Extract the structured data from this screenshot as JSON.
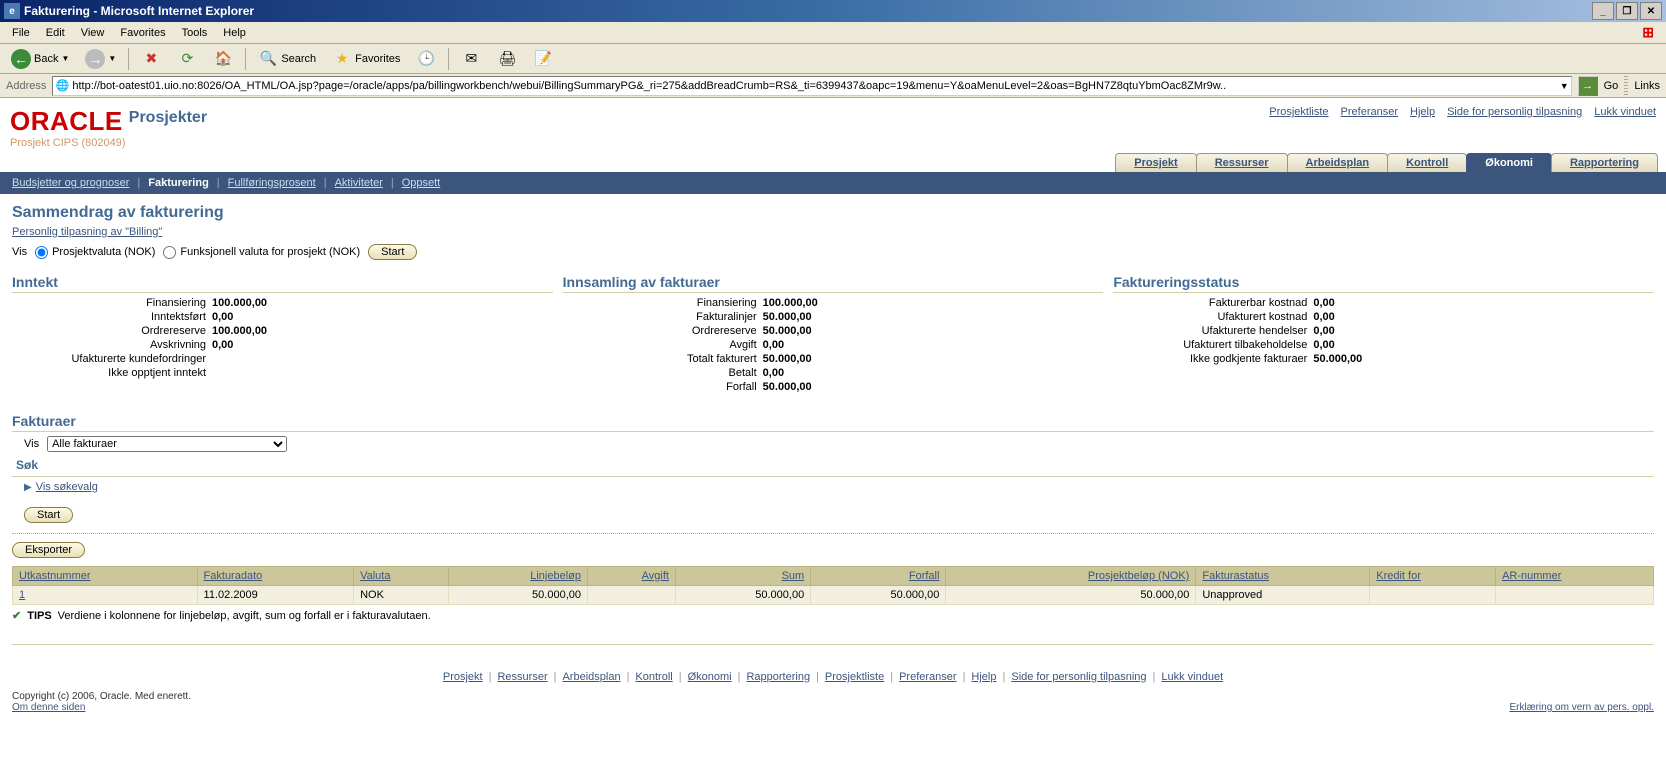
{
  "window": {
    "title": "Fakturering - Microsoft Internet Explorer"
  },
  "menu": {
    "file": "File",
    "edit": "Edit",
    "view": "View",
    "favorites": "Favorites",
    "tools": "Tools",
    "help": "Help"
  },
  "toolbar": {
    "back": "Back",
    "search": "Search",
    "favorites": "Favorites"
  },
  "address": {
    "label": "Address",
    "url": "http://bot-oatest01.uio.no:8026/OA_HTML/OA.jsp?page=/oracle/apps/pa/billingworkbench/webui/BillingSummaryPG&_ri=275&addBreadCrumb=RS&_ti=6399437&oapc=19&menu=Y&oaMenuLevel=2&oas=BgHN7Z8qtuYbmOac8ZMr9w..",
    "go": "Go",
    "links": "Links"
  },
  "header": {
    "logo": "ORACLE",
    "app": "Prosjekter",
    "links": {
      "prosjektliste": "Prosjektliste",
      "pref": "Preferanser",
      "hjelp": "Hjelp",
      "side": "Side for personlig tilpasning",
      "lukk": "Lukk vinduet"
    },
    "project": "Prosjekt CIPS (802049)"
  },
  "tabs1": [
    {
      "label": "Prosjekt"
    },
    {
      "label": "Ressurser"
    },
    {
      "label": "Arbeidsplan"
    },
    {
      "label": "Kontroll"
    },
    {
      "label": "Økonomi",
      "sel": true
    },
    {
      "label": "Rapportering"
    }
  ],
  "subtabs": [
    {
      "label": "Budsjetter og prognoser"
    },
    {
      "label": "Fakturering",
      "sel": true
    },
    {
      "label": "Fullføringsprosent"
    },
    {
      "label": "Aktiviteter"
    },
    {
      "label": "Oppsett"
    }
  ],
  "page": {
    "title": "Sammendrag av fakturering",
    "personalize": "Personlig tilpasning av \"Billing\""
  },
  "vis": {
    "label": "Vis",
    "opt1": "Prosjektvaluta (NOK)",
    "opt2": "Funksjonell valuta for prosjekt (NOK)",
    "start": "Start"
  },
  "inntekt": {
    "title": "Inntekt",
    "rows": [
      {
        "k": "Finansiering",
        "v": "100.000,00"
      },
      {
        "k": "Inntektsført",
        "v": "0,00"
      },
      {
        "k": "Ordrereserve",
        "v": "100.000,00"
      },
      {
        "k": "Avskrivning",
        "v": "0,00"
      },
      {
        "k": "Ufakturerte kundefordringer",
        "v": ""
      },
      {
        "k": "Ikke opptjent inntekt",
        "v": ""
      }
    ]
  },
  "innsamling": {
    "title": "Innsamling av fakturaer",
    "rows": [
      {
        "k": "Finansiering",
        "v": "100.000,00"
      },
      {
        "k": "Fakturalinjer",
        "v": "50.000,00"
      },
      {
        "k": "Ordrereserve",
        "v": "50.000,00"
      },
      {
        "k": "Avgift",
        "v": "0,00"
      },
      {
        "k": "Totalt fakturert",
        "v": "50.000,00"
      },
      {
        "k": "Betalt",
        "v": "0,00"
      },
      {
        "k": "Forfall",
        "v": "50.000,00"
      }
    ]
  },
  "status": {
    "title": "Faktureringsstatus",
    "rows": [
      {
        "k": "Fakturerbar kostnad",
        "v": "0,00"
      },
      {
        "k": "Ufakturert kostnad",
        "v": "0,00"
      },
      {
        "k": "Ufakturerte hendelser",
        "v": "0,00"
      },
      {
        "k": "Ufakturert tilbakeholdelse",
        "v": "0,00"
      },
      {
        "k": "Ikke godkjente fakturaer",
        "v": "50.000,00"
      }
    ]
  },
  "fakturaer": {
    "title": "Fakturaer",
    "visLabel": "Vis",
    "selectValue": "Alle fakturaer",
    "sok": "Søk",
    "visSoke": "Vis søkevalg",
    "start": "Start",
    "eksporter": "Eksporter",
    "cols": [
      "Utkastnummer",
      "Fakturadato",
      "Valuta",
      "Linjebeløp",
      "Avgift",
      "Sum",
      "Forfall",
      "Prosjektbeløp (NOK)",
      "Fakturastatus",
      "Kredit for",
      "AR-nummer"
    ],
    "row": {
      "nr": "1",
      "dato": "11.02.2009",
      "valuta": "NOK",
      "linje": "50.000,00",
      "avgift": "",
      "sum": "50.000,00",
      "forfall": "50.000,00",
      "pros": "50.000,00",
      "stat": "Unapproved",
      "kredit": "",
      "ar": ""
    },
    "tip": {
      "label": "TIPS",
      "text": "Verdiene i kolonnene for linjebeløp, avgift, sum og forfall er i fakturavalutaen."
    }
  },
  "footer": {
    "links": [
      "Prosjekt",
      "Ressurser",
      "Arbeidsplan",
      "Kontroll",
      "Økonomi",
      "Rapportering",
      "Prosjektliste",
      "Preferanser",
      "Hjelp",
      "Side for personlig tilpasning",
      "Lukk vinduet"
    ],
    "copyright": "Copyright (c) 2006, Oracle. Med enerett.",
    "about": "Om denne siden",
    "privacy": "Erklæring om vern av pers. oppl."
  }
}
